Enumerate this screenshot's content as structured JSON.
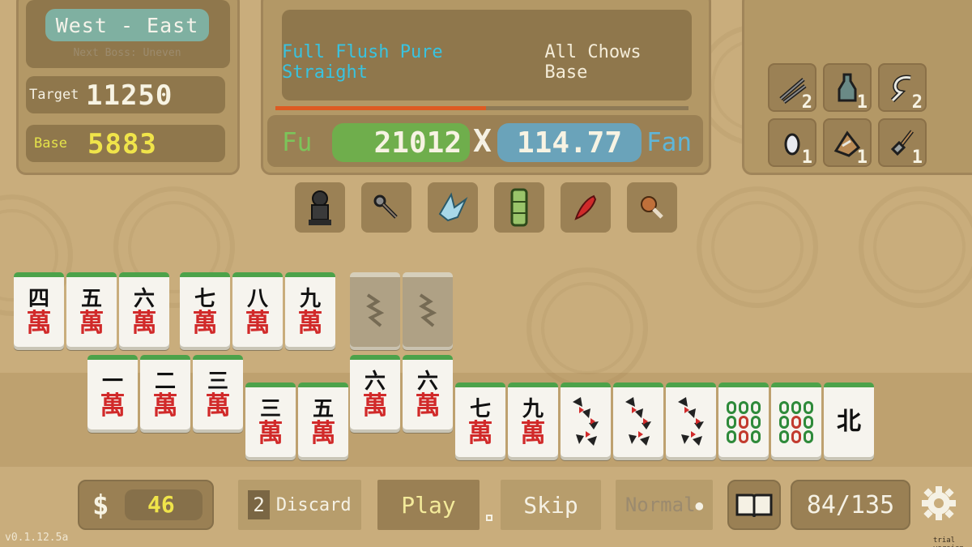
{
  "round": {
    "label": "West - East",
    "next_boss": "Next Boss: Uneven"
  },
  "stats": {
    "target_label": "Target",
    "target_value": "11250",
    "base_label": "Base",
    "base_value": "5883"
  },
  "hand": {
    "highlight_text": "Full Flush Pure Straight",
    "plain_text": "All Chows Base",
    "progress": 0.51
  },
  "score": {
    "fu_label": "Fu",
    "fu_value": "21012",
    "times": "X",
    "fan_value": "114.77",
    "fan_label": "Fan"
  },
  "consumables": [
    {
      "icon": "chopsticks-icon",
      "count": "2"
    },
    {
      "icon": "bottle-icon",
      "count": "1"
    },
    {
      "icon": "hook-icon",
      "count": "2"
    },
    {
      "icon": "feather-icon",
      "count": "1"
    },
    {
      "icon": "scroll-icon",
      "count": "1"
    },
    {
      "icon": "shovel-icon",
      "count": "1"
    }
  ],
  "relics": [
    {
      "icon": "statue-icon"
    },
    {
      "icon": "ladle-icon"
    },
    {
      "icon": "crane-icon"
    },
    {
      "icon": "bamboo-icon"
    },
    {
      "icon": "pepper-icon"
    },
    {
      "icon": "drumstick-icon"
    }
  ],
  "melds_row": [
    {
      "top": "四",
      "bottom": "萬"
    },
    {
      "top": "五",
      "bottom": "萬"
    },
    {
      "top": "六",
      "bottom": "萬"
    },
    {
      "top": "七",
      "bottom": "萬"
    },
    {
      "top": "八",
      "bottom": "萬"
    },
    {
      "top": "九",
      "bottom": "萬"
    }
  ],
  "hand_tiles": [
    {
      "top": "一",
      "bottom": "萬"
    },
    {
      "top": "二",
      "bottom": "萬"
    },
    {
      "top": "三",
      "bottom": "萬"
    },
    {
      "top": "三",
      "bottom": "萬"
    },
    {
      "top": "五",
      "bottom": "萬"
    },
    {
      "top": "六",
      "bottom": "萬"
    },
    {
      "top": "六",
      "bottom": "萬"
    },
    {
      "top": "七",
      "bottom": "萬"
    },
    {
      "top": "九",
      "bottom": "萬"
    },
    {
      "top": "",
      "bottom": ""
    },
    {
      "top": "",
      "bottom": ""
    },
    {
      "top": "",
      "bottom": ""
    },
    {
      "top": "",
      "bottom": ""
    },
    {
      "top": "",
      "bottom": ""
    },
    {
      "top": "北",
      "bottom": ""
    }
  ],
  "bottom": {
    "currency": "$",
    "money": "46",
    "discards": "2",
    "discard_label": "Discard",
    "play_label": "Play",
    "skip_label": "Skip",
    "mode_label": "Normal",
    "deck_count": "84/135"
  },
  "version": "v0.1.12.5a",
  "trial": "trial version"
}
